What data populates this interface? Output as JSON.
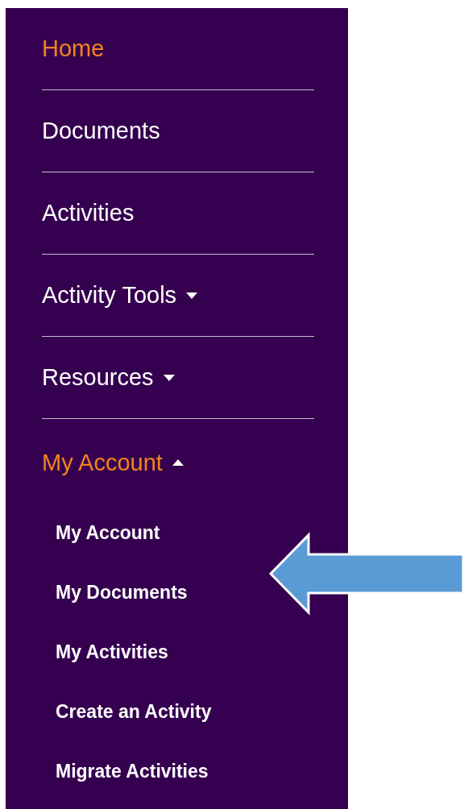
{
  "nav": [
    {
      "label": "Home",
      "selected": true
    },
    {
      "label": "Documents",
      "selected": false
    },
    {
      "label": "Activities",
      "selected": false
    },
    {
      "label": "Activity Tools",
      "selected": false,
      "expanded": false
    },
    {
      "label": "Resources",
      "selected": false,
      "expanded": false
    },
    {
      "label": "My Account",
      "selected": true,
      "expanded": true,
      "children": [
        {
          "label": "My Account"
        },
        {
          "label": "My Documents"
        },
        {
          "label": "My Activities"
        },
        {
          "label": "Create an Activity"
        },
        {
          "label": "Migrate Activities"
        }
      ]
    }
  ]
}
